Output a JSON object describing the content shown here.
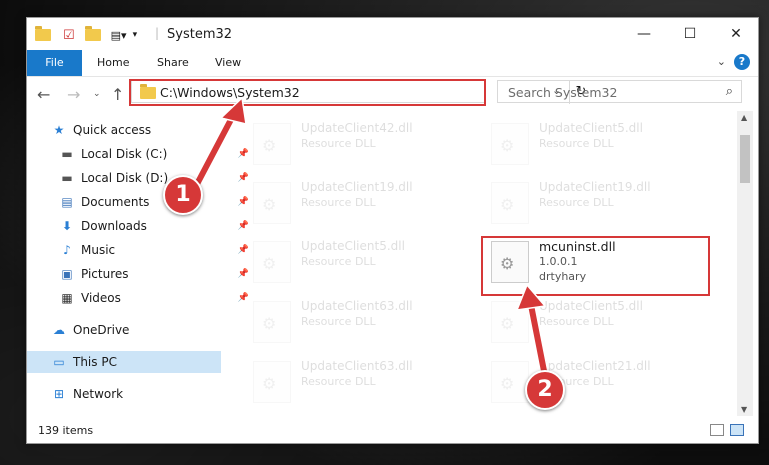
{
  "window": {
    "title": "System32",
    "controls": {
      "minimize": "—",
      "maximize": "☐",
      "close": "✕"
    }
  },
  "ribbon": {
    "tabs": [
      "File",
      "Home",
      "Share",
      "View"
    ],
    "help": "?"
  },
  "address": {
    "path": "C:\\Windows\\System32",
    "search_placeholder": "Search System32"
  },
  "sidebar": {
    "items": [
      {
        "label": "Quick access",
        "icon": "star-icon"
      },
      {
        "label": "Local Disk (C:)",
        "icon": "drive-icon"
      },
      {
        "label": "Local Disk (D:)",
        "icon": "drive-icon"
      },
      {
        "label": "Documents",
        "icon": "documents-icon"
      },
      {
        "label": "Downloads",
        "icon": "download-icon"
      },
      {
        "label": "Music",
        "icon": "music-icon"
      },
      {
        "label": "Pictures",
        "icon": "pictures-icon"
      },
      {
        "label": "Videos",
        "icon": "videos-icon"
      },
      {
        "label": "OneDrive",
        "icon": "cloud-icon"
      },
      {
        "label": "This PC",
        "icon": "computer-icon"
      },
      {
        "label": "Network",
        "icon": "network-icon"
      }
    ]
  },
  "files": [
    {
      "name": "UpdateClient42.dll",
      "desc": "Resource DLL",
      "faded": true
    },
    {
      "name": "UpdateClient5.dll",
      "desc": "Resource DLL",
      "faded": true
    },
    {
      "name": "UpdateClient19.dll",
      "desc": "Resource DLL",
      "faded": true
    },
    {
      "name": "UpdateClient19.dll",
      "desc": "Resource DLL",
      "faded": true
    },
    {
      "name": "UpdateClient5.dll",
      "desc": "Resource DLL",
      "faded": true
    },
    {
      "name": "mcuninst.dll",
      "version": "1.0.0.1",
      "company": "drtyhary",
      "faded": false
    },
    {
      "name": "UpdateClient63.dll",
      "desc": "Resource DLL",
      "faded": true
    },
    {
      "name": "UpdateClient5.dll",
      "desc": "Resource DLL",
      "faded": true
    },
    {
      "name": "UpdateClient63.dll",
      "desc": "Resource DLL",
      "faded": true
    },
    {
      "name": "UpdateClient21.dll",
      "desc": "Resource DLL",
      "faded": true
    }
  ],
  "status": {
    "items": "139 items"
  },
  "annotations": {
    "badge1": "1",
    "badge2": "2",
    "color": "#d63838"
  }
}
